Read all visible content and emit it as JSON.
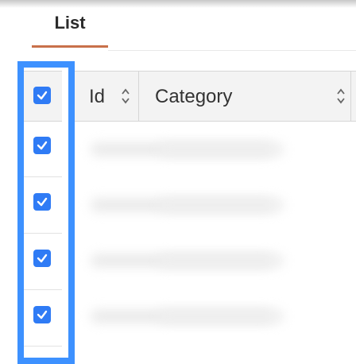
{
  "tabs": [
    {
      "label": "List",
      "active": true
    }
  ],
  "table": {
    "columns": [
      {
        "label": "Id",
        "sortable": true
      },
      {
        "label": "Category",
        "sortable": true
      }
    ],
    "select_all_checked": true,
    "row_checked": [
      true,
      true,
      true,
      true
    ]
  },
  "colors": {
    "tab_underline": "#c8704a",
    "highlight_border": "#3d91ff",
    "checkbox": "#2f7bf5"
  }
}
